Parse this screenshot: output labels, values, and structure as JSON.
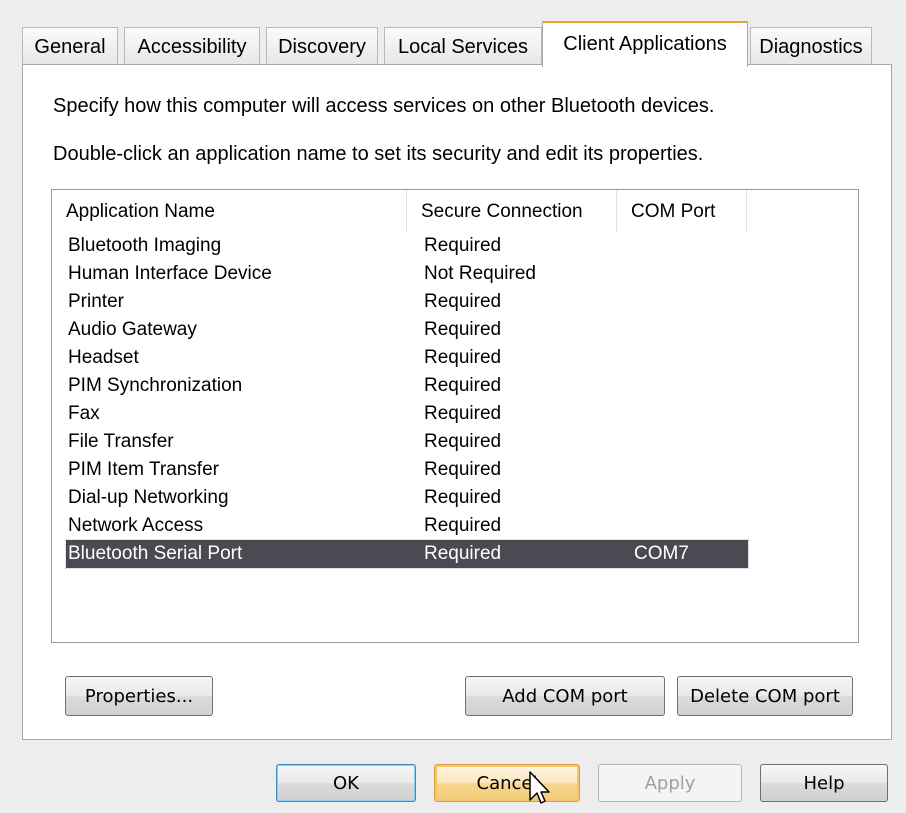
{
  "tabs": [
    {
      "label": "General",
      "active": false
    },
    {
      "label": "Accessibility",
      "active": false
    },
    {
      "label": "Discovery",
      "active": false
    },
    {
      "label": "Local Services",
      "active": false
    },
    {
      "label": "Client Applications",
      "active": true
    },
    {
      "label": "Diagnostics",
      "active": false
    }
  ],
  "description": {
    "line1": "Specify how this computer will access services on other Bluetooth devices.",
    "line2": "Double-click an application name to set its security and edit its properties."
  },
  "list": {
    "columns": [
      "Application Name",
      "Secure Connection",
      "COM Port"
    ],
    "rows": [
      {
        "name": "Bluetooth Imaging",
        "secure": "Required",
        "com": ""
      },
      {
        "name": "Human Interface Device",
        "secure": "Not Required",
        "com": ""
      },
      {
        "name": "Printer",
        "secure": "Required",
        "com": ""
      },
      {
        "name": "Audio Gateway",
        "secure": "Required",
        "com": ""
      },
      {
        "name": "Headset",
        "secure": "Required",
        "com": ""
      },
      {
        "name": "PIM Synchronization",
        "secure": "Required",
        "com": ""
      },
      {
        "name": "Fax",
        "secure": "Required",
        "com": ""
      },
      {
        "name": "File Transfer",
        "secure": "Required",
        "com": ""
      },
      {
        "name": "PIM Item Transfer",
        "secure": "Required",
        "com": ""
      },
      {
        "name": "Dial-up Networking",
        "secure": "Required",
        "com": ""
      },
      {
        "name": "Network Access",
        "secure": "Required",
        "com": ""
      },
      {
        "name": "Bluetooth Serial Port",
        "secure": "Required",
        "com": "COM7",
        "selected": true
      }
    ]
  },
  "panel_buttons": {
    "properties": "Properties...",
    "add_com": "Add COM port",
    "delete_com": "Delete COM port"
  },
  "dialog_buttons": {
    "ok": "OK",
    "cancel": "Cancel",
    "apply": "Apply",
    "help": "Help"
  },
  "colors": {
    "active_tab_accent": "#e9a23b",
    "selection_bg": "#4a4a52",
    "default_button_border": "#3b89c4",
    "hover_button_border": "#d8a23a"
  }
}
